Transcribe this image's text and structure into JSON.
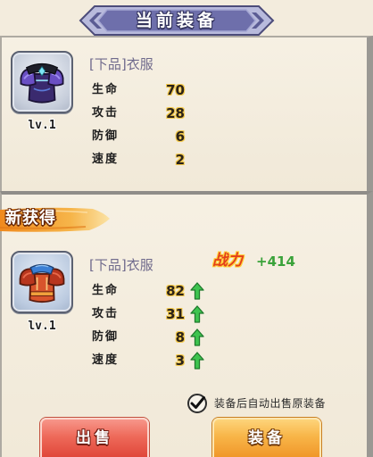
{
  "current": {
    "banner_title": "当前装备",
    "item": {
      "icon": "purple-armor-icon",
      "name": "[下品]衣服",
      "level": "lv.1",
      "stats": [
        {
          "label": "生命",
          "value": "70"
        },
        {
          "label": "攻击",
          "value": "28"
        },
        {
          "label": "防御",
          "value": "6"
        },
        {
          "label": "速度",
          "value": "2"
        }
      ]
    }
  },
  "new": {
    "ribbon_title": "新获得",
    "item": {
      "icon": "red-armor-icon",
      "name": "[下品]衣服",
      "level": "lv.1",
      "power_label": "战力",
      "power_value": "+414",
      "stats": [
        {
          "label": "生命",
          "value": "82",
          "trend_icon": "up-arrow-icon"
        },
        {
          "label": "攻击",
          "value": "31",
          "trend_icon": "up-arrow-icon"
        },
        {
          "label": "防御",
          "value": "8",
          "trend_icon": "up-arrow-icon"
        },
        {
          "label": "速度",
          "value": "3",
          "trend_icon": "up-arrow-icon"
        }
      ]
    }
  },
  "auto_sell": {
    "checked": true,
    "label": "装备后自动出售原装备"
  },
  "buttons": {
    "sell": "出售",
    "equip": "装备"
  },
  "colors": {
    "background": "#f3ecdd",
    "banner": "#6e6fab",
    "ribbon": "#f6b54a",
    "item_name": "#6f6a8c",
    "power_label": "#e4401c",
    "power_value": "#3aa23a",
    "stat_up": "#3ec44f",
    "sell_button": "#e0473a",
    "equip_button": "#f0972a"
  }
}
